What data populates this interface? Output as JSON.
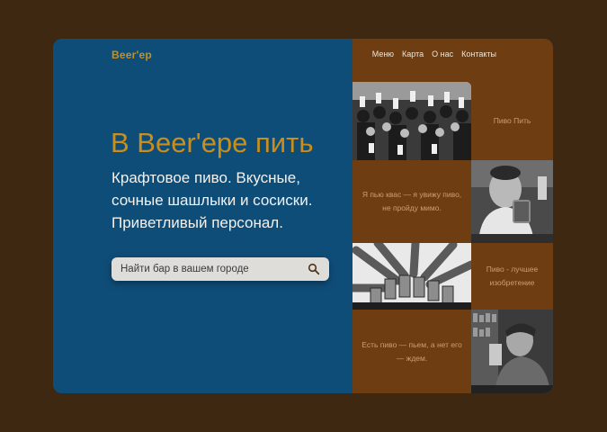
{
  "brand": {
    "logo": "Beer'ep"
  },
  "nav": [
    "Меню",
    "Карта",
    "О нас",
    "Контакты"
  ],
  "hero": {
    "headline": "В Beer'epe пить",
    "subtitle_lines": [
      "Крафтовое пиво. Вкусные,",
      "сочные шашлыки и сосиски.",
      "Приветливый персонал."
    ]
  },
  "search": {
    "placeholder": "Найти бар в вашем городе",
    "value": ""
  },
  "tiles": {
    "quote1": "Пиво Пить",
    "quote2": "Я пью квас — я увижу пиво, не пройду мимо.",
    "quote3": "Пиво - лучшее изобретение",
    "quote4": "Есть пиво — пьем, а нет его — ждем."
  },
  "icons": {
    "search": "search-icon"
  },
  "colors": {
    "page_bg": "#3e2812",
    "left_panel": "#0f4d79",
    "right_panel": "#6f3d12",
    "accent_gold": "#c88f1e",
    "quote_text": "#c8a06f",
    "search_bg": "#dfddda"
  }
}
